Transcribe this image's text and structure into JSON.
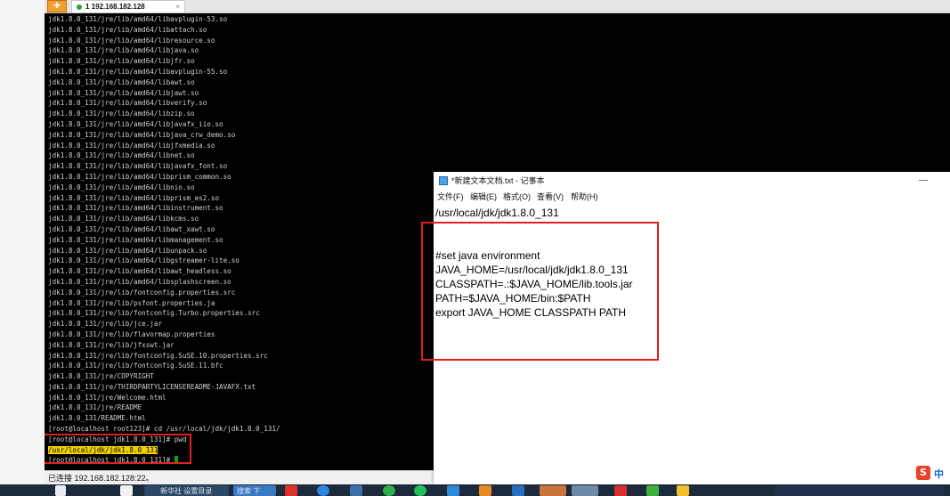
{
  "tabbar": {
    "session_tab_label": "1 192.168.182.128",
    "close_glyph": "×"
  },
  "terminal": {
    "lines": [
      "jdk1.8.0_131/jre/lib/amd64/libavplugin-53.so",
      "jdk1.8.0_131/jre/lib/amd64/libattach.so",
      "jdk1.8.0_131/jre/lib/amd64/libresource.so",
      "jdk1.8.0_131/jre/lib/amd64/libjava.so",
      "jdk1.8.0_131/jre/lib/amd64/libjfr.so",
      "jdk1.8.0_131/jre/lib/amd64/libavplugin-55.so",
      "jdk1.8.0_131/jre/lib/amd64/libawt.so",
      "jdk1.8.0_131/jre/lib/amd64/libjawt.so",
      "jdk1.8.0_131/jre/lib/amd64/libverify.so",
      "jdk1.8.0_131/jre/lib/amd64/libzip.so",
      "jdk1.8.0_131/jre/lib/amd64/libjavafx_iio.so",
      "jdk1.8.0_131/jre/lib/amd64/libjava_crw_demo.so",
      "jdk1.8.0_131/jre/lib/amd64/libjfxmedia.so",
      "jdk1.8.0_131/jre/lib/amd64/libnet.so",
      "jdk1.8.0_131/jre/lib/amd64/libjavafx_font.so",
      "jdk1.8.0_131/jre/lib/amd64/libprism_common.so",
      "jdk1.8.0_131/jre/lib/amd64/libnio.so",
      "jdk1.8.0_131/jre/lib/amd64/libprism_es2.so",
      "jdk1.8.0_131/jre/lib/amd64/libinstrument.so",
      "jdk1.8.0_131/jre/lib/amd64/libkcms.so",
      "jdk1.8.0_131/jre/lib/amd64/libawt_xawt.so",
      "jdk1.8.0_131/jre/lib/amd64/libmanagement.so",
      "jdk1.8.0_131/jre/lib/amd64/libunpack.so",
      "jdk1.8.0_131/jre/lib/amd64/libgstreamer-lite.so",
      "jdk1.8.0_131/jre/lib/amd64/libawt_headless.so",
      "jdk1.8.0_131/jre/lib/amd64/libsplashscreen.so",
      "jdk1.8.0_131/jre/lib/fontconfig.properties.src",
      "jdk1.8.0_131/jre/lib/psfont.properties.ja",
      "jdk1.8.0_131/jre/lib/fontconfig.Turbo.properties.src",
      "jdk1.8.0_131/jre/lib/jce.jar",
      "jdk1.8.0_131/jre/lib/flavormap.properties",
      "jdk1.8.0_131/jre/lib/jfxswt.jar",
      "jdk1.8.0_131/jre/lib/fontconfig.SuSE.10.properties.src",
      "jdk1.8.0_131/jre/lib/fontconfig.SuSE.11.bfc",
      "jdk1.8.0_131/jre/COPYRIGHT",
      "jdk1.8.0_131/jre/THIRDPARTYLICENSEREADME-JAVAFX.txt",
      "jdk1.8.0_131/jre/Welcome.html",
      "jdk1.8.0_131/jre/README",
      "jdk1.8.0_131/README.html",
      "[root@localhost root123]# cd /usr/local/jdk/jdk1.8.0_131/",
      "[root@localhost jdk1.8.0_131]# pwd"
    ],
    "pwd_output": "/usr/local/jdk/jdk1.8.0_131",
    "last_prompt": "[root@localhost jdk1.8.0_131]# "
  },
  "statusbar": {
    "text": "已连接 192.168.182.128:22。"
  },
  "notepad": {
    "title": "*新建文本文档.txt - 记事本",
    "minimize_glyph": "—",
    "menu": [
      "文件(F)",
      "编辑(E)",
      "格式(O)",
      "查看(V)",
      "帮助(H)"
    ],
    "content": "/usr/local/jdk/jdk1.8.0_131\n\n\n#set java environment\nJAVA_HOME=/usr/local/jdk/jdk1.8.0_131\nCLASSPATH=.:$JAVA_HOME/lib.tools.jar\nPATH=$JAVA_HOME/bin:$PATH\nexport JAVA_HOME CLASSPATH PATH"
  },
  "taskbar": {
    "items": [
      "新华社 设置目录",
      "搜索 下"
    ]
  },
  "ime": {
    "icon_glyph": "S",
    "mode": "中"
  },
  "colors": {
    "terminal_bg": "#000000",
    "terminal_fg": "#d0d0d0",
    "highlight_box": "#e02020",
    "selection": "#f0d000",
    "cursor": "#00aa00"
  }
}
